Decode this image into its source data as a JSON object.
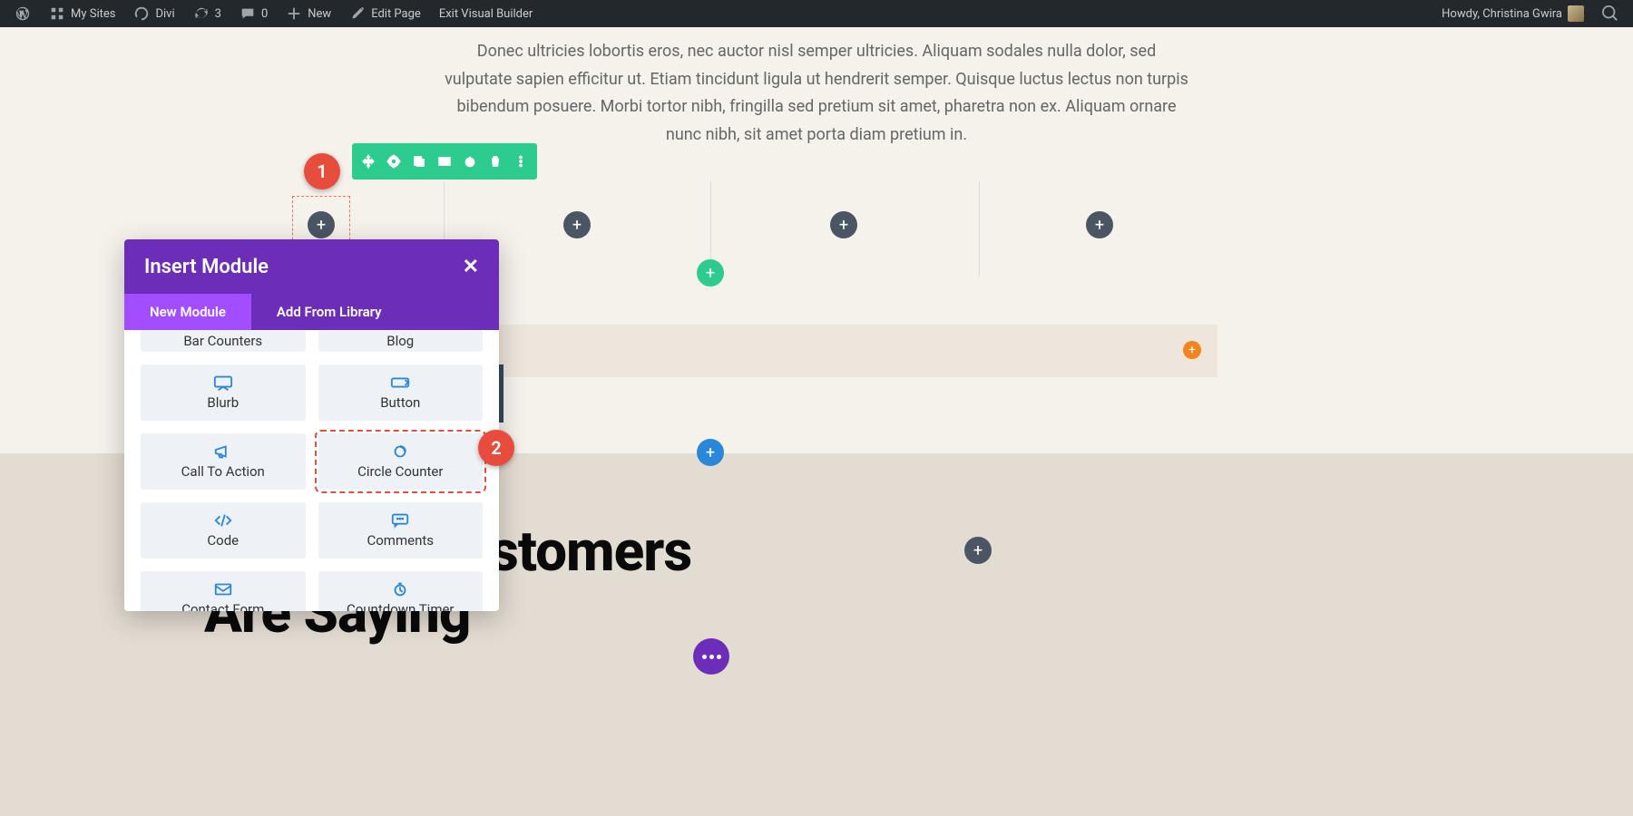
{
  "adminbar": {
    "my_sites": "My Sites",
    "divi": "Divi",
    "updates": "3",
    "comments": "0",
    "new": "New",
    "edit_page": "Edit Page",
    "exit_vb": "Exit Visual Builder",
    "howdy": "Howdy, Christina Gwira"
  },
  "hero": {
    "text": "Donec ultricies lobortis eros, nec auctor nisl semper ultricies. Aliquam sodales nulla dolor, sed vulputate sapien efficitur ut. Etiam tincidunt ligula ut hendrerit semper. Quisque luctus lectus non turpis bibendum posuere. Morbi tortor nibh, fringilla sed pretium sit amet, pharetra non ex. Aliquam ornare nunc nibh, sit amet porta diam pretium in."
  },
  "callouts": {
    "one": "1",
    "two": "2"
  },
  "popover": {
    "title": "Insert Module",
    "tab_new": "New Module",
    "tab_lib": "Add From Library",
    "items": {
      "bar_counters": "Bar Counters",
      "blog": "Blog",
      "blurb": "Blurb",
      "button": "Button",
      "cta": "Call To Action",
      "circle_counter": "Circle Counter",
      "code": "Code",
      "comments": "Comments",
      "contact_form": "Contact Form",
      "countdown": "Countdown Timer"
    }
  },
  "lower": {
    "heading_visible": "stomers\nAre Saying"
  }
}
